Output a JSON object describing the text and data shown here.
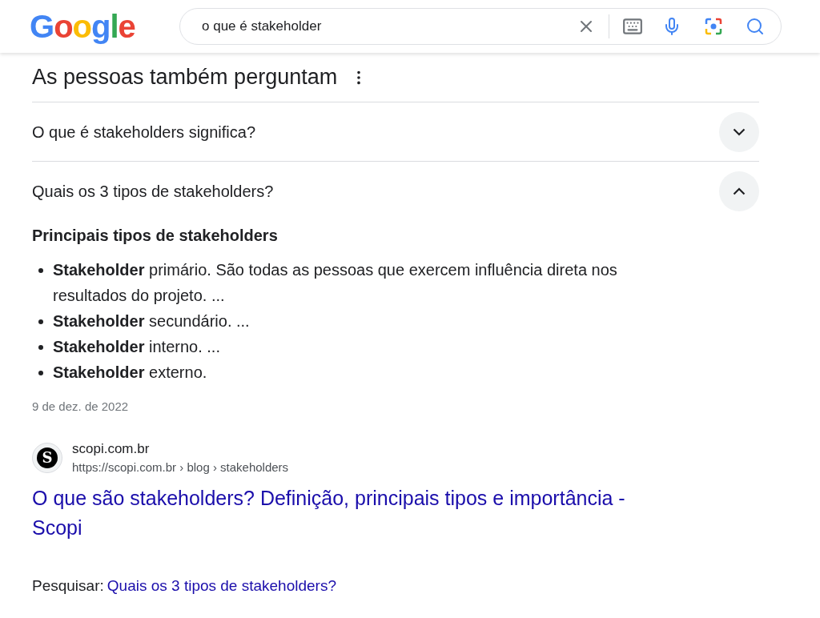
{
  "logo": "Google",
  "search": {
    "value": "o que é stakeholder"
  },
  "section": {
    "title": "As pessoas também perguntam"
  },
  "questions": [
    {
      "text": "O que é stakeholders significa?",
      "expanded": false
    },
    {
      "text": "Quais os 3 tipos de stakeholders?",
      "expanded": true,
      "answer": {
        "heading": "Principais tipos de stakeholders",
        "bullets": [
          "**Stakeholder** primário. São todas as pessoas que exercem influência direta nos resultados do projeto. ...",
          "**Stakeholder** secundário. ...",
          "**Stakeholder** interno. ...",
          "**Stakeholder** externo."
        ],
        "date": "9 de dez. de 2022",
        "source": {
          "favicon_letter": "S",
          "site": "scopi.com.br",
          "url": "https://scopi.com.br › blog › stakeholders",
          "title": "O que são stakeholders? Definição, principais tipos e importância - Scopi"
        },
        "search_prompt": "Pesquisar:",
        "search_link": "Quais os 3 tipos de stakeholders?"
      }
    }
  ]
}
